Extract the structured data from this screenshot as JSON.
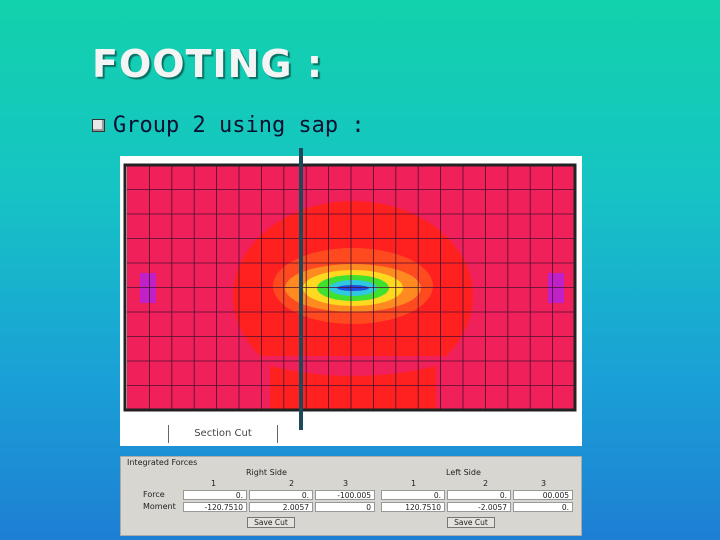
{
  "slide": {
    "title": "FOOTING :",
    "bullet": "Group 2 using sap :"
  },
  "plot": {
    "section_cut_label": "Section Cut",
    "colors": {
      "background": "#f0205a",
      "outer_zone": "#ff2020",
      "orange_zone": "#ff8a20",
      "yellow_zone": "#ffd820",
      "green_zone": "#40e030",
      "cyan_zone": "#30c8e0",
      "blue_zone": "#2050e0",
      "support_patch": "#c020c8",
      "grid": "#4a1030"
    }
  },
  "integrated_forces": {
    "title": "Integrated Forces",
    "right_side": {
      "label": "Right Side",
      "headers": [
        "1",
        "2",
        "3"
      ],
      "force": [
        "0.",
        "0.",
        "-100.005"
      ],
      "moment": [
        "-120.7510",
        "2.0057",
        "0"
      ],
      "button": "Save Cut"
    },
    "left_side": {
      "label": "Left Side",
      "headers": [
        "1",
        "2",
        "3"
      ],
      "force": [
        "0.",
        "0.",
        "00.005"
      ],
      "moment": [
        "120.7510",
        "-2.0057",
        "0."
      ],
      "button": "Save Cut"
    },
    "row_labels": [
      "Force",
      "Moment"
    ]
  }
}
